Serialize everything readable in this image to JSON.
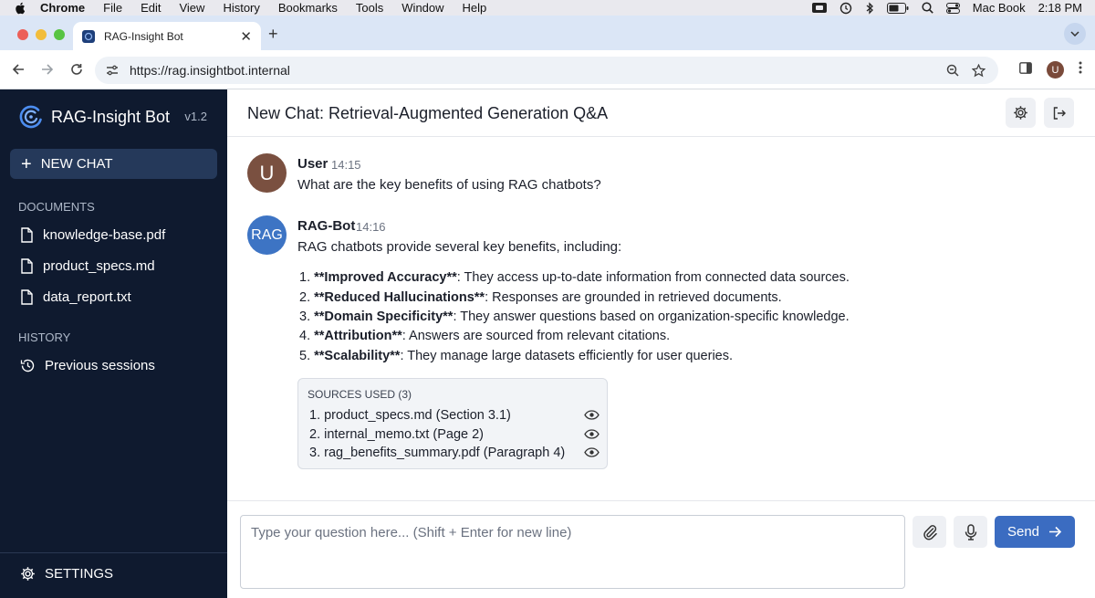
{
  "menubar": {
    "app": "Chrome",
    "items": [
      "File",
      "Edit",
      "View",
      "History",
      "Bookmarks",
      "Tools",
      "Window",
      "Help"
    ],
    "clock_name": "Mac Book",
    "time": "2:18 PM"
  },
  "browser": {
    "tab_title": "RAG-Insight Bot",
    "url": "https://rag.insightbot.internal",
    "profile_initial": "U"
  },
  "sidebar": {
    "brand": "RAG-Insight Bot",
    "version": "v1.2",
    "new_chat": "NEW CHAT",
    "documents_label": "DOCUMENTS",
    "documents": [
      "knowledge-base.pdf",
      "product_specs.md",
      "data_report.txt"
    ],
    "history_label": "HISTORY",
    "history_item": "Previous sessions",
    "settings": "SETTINGS"
  },
  "chat": {
    "title": "New Chat: Retrieval-Augmented Generation Q&A",
    "user": {
      "avatar": "U",
      "name": "User",
      "time": "14:15",
      "text": "What are the key benefits of using RAG chatbots?"
    },
    "bot": {
      "avatar": "RAG",
      "name": "RAG-Bot",
      "time": "14:16",
      "intro": "RAG chatbots provide several key benefits, including:",
      "points": [
        {
          "num": "1.",
          "term": "**Improved Accuracy**",
          "desc": ": They access up-to-date information from connected data sources."
        },
        {
          "num": "2.",
          "term": "**Reduced Hallucinations**",
          "desc": ": Responses are grounded in retrieved documents."
        },
        {
          "num": "3.",
          "term": "**Domain Specificity**",
          "desc": ": They answer questions based on organization-specific knowledge."
        },
        {
          "num": "4.",
          "term": "**Attribution**",
          "desc": ": Answers are sourced from relevant citations."
        },
        {
          "num": "5.",
          "term": "**Scalability**",
          "desc": ": They manage large datasets efficiently for user queries."
        }
      ],
      "sources_header": "SOURCES USED (3)",
      "sources": [
        "1. product_specs.md (Section 3.1)",
        "2. internal_memo.txt (Page 2)",
        "3. rag_benefits_summary.pdf (Paragraph 4)"
      ]
    }
  },
  "composer": {
    "placeholder": "Type your question here... (Shift + Enter for new line)",
    "send": "Send"
  },
  "colors": {
    "sidebar_bg": "#0f1a2f",
    "accent": "#3b6cc1",
    "bot_avatar": "#3d74c4",
    "user_avatar": "#7a5040"
  }
}
